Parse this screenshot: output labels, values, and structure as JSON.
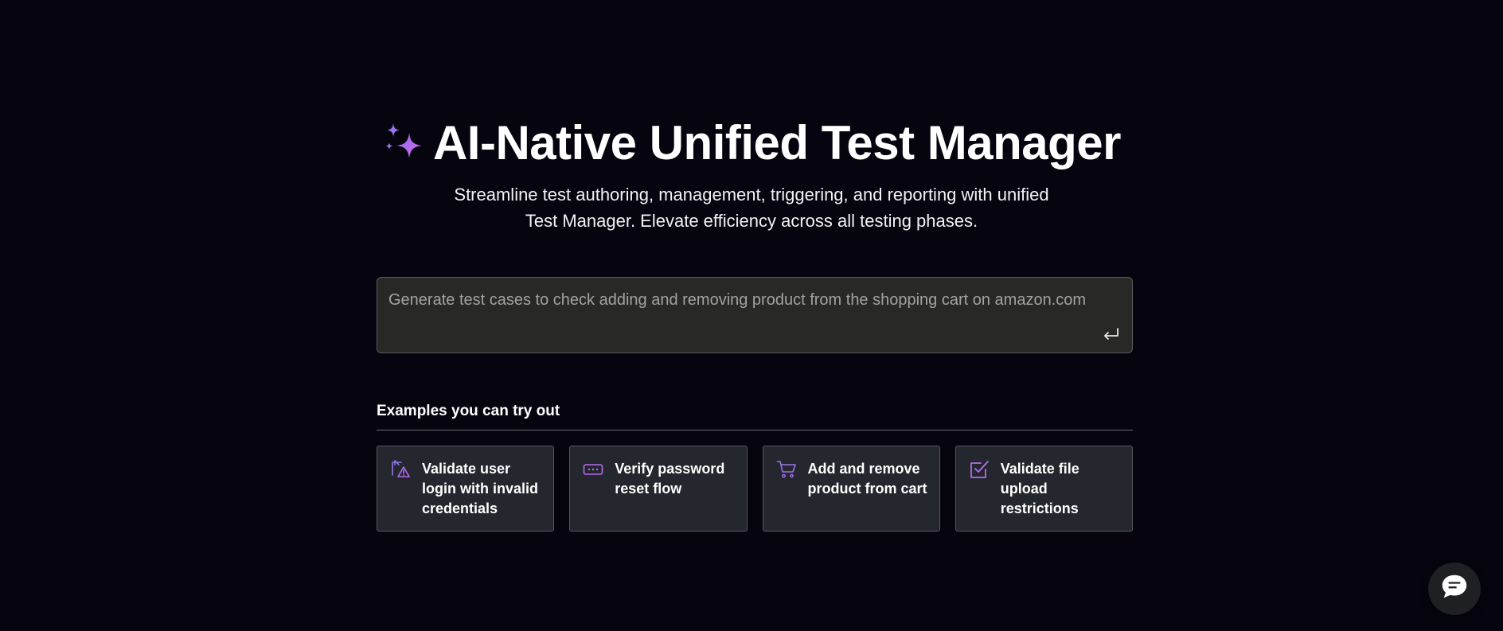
{
  "hero": {
    "title": "AI-Native Unified Test Manager",
    "subtitle_line1": "Streamline test authoring, management, triggering, and reporting with unified",
    "subtitle_line2": "Test Manager. Elevate efficiency across all testing phases."
  },
  "prompt": {
    "placeholder": "Generate test cases to check adding and removing product from the shopping cart on amazon.com",
    "value": "",
    "submit_icon": "enter-icon"
  },
  "examples": {
    "heading": "Examples you can try out",
    "cards": [
      {
        "label": "Validate user login with invalid credentials",
        "icon": "login-warning-icon"
      },
      {
        "label": "Verify password reset flow",
        "icon": "password-field-icon"
      },
      {
        "label": "Add and remove product from cart",
        "icon": "shopping-cart-icon"
      },
      {
        "label": "Validate file upload restrictions",
        "icon": "checkbox-icon"
      }
    ]
  },
  "chat_widget": {
    "icon": "chat-bubble-icon"
  },
  "colors": {
    "background": "#06050f",
    "accent": "#b56cf0",
    "card_bg": "#24272d",
    "prompt_bg": "#282826"
  }
}
